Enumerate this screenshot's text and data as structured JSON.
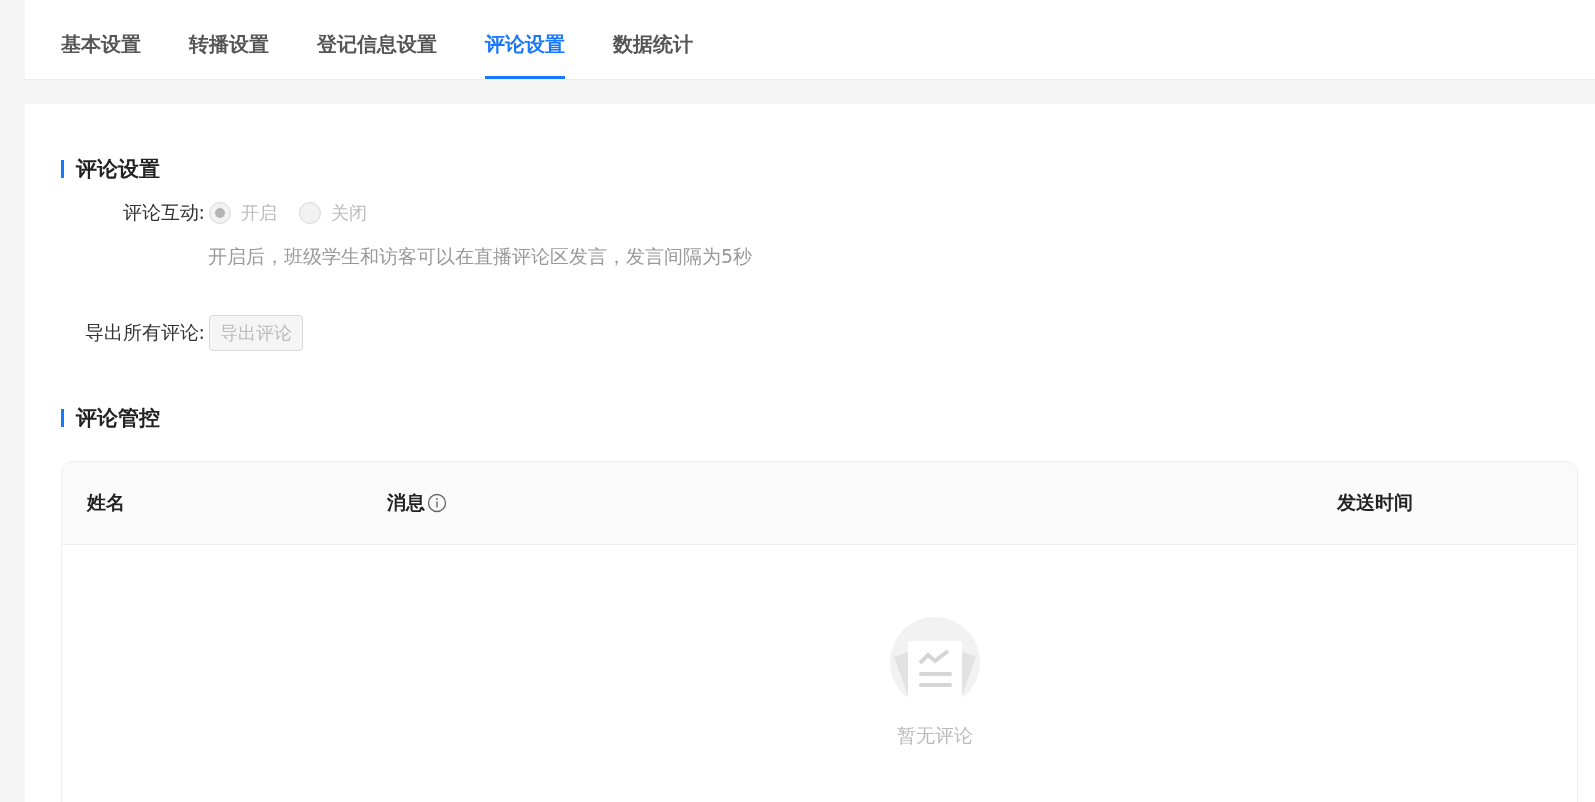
{
  "tabs": [
    {
      "label": "基本设置",
      "selected": false
    },
    {
      "label": "转播设置",
      "selected": false
    },
    {
      "label": "登记信息设置",
      "selected": false
    },
    {
      "label": "评论设置",
      "selected": true
    },
    {
      "label": "数据统计",
      "selected": false
    }
  ],
  "comment_settings": {
    "title": "评论设置",
    "interaction": {
      "label": "评论互动:",
      "disabled": true,
      "options": [
        {
          "label": "开启",
          "selected": true
        },
        {
          "label": "关闭",
          "selected": false
        }
      ],
      "hint": "开启后，班级学生和访客可以在直播评论区发言，发言间隔为5秒"
    },
    "export": {
      "label": "导出所有评论:",
      "button": "导出评论",
      "disabled": true
    }
  },
  "comment_control": {
    "title": "评论管控",
    "table": {
      "columns": [
        {
          "label": "姓名",
          "kind": "plain"
        },
        {
          "label": "消息",
          "kind": "with_info"
        },
        {
          "label": "发送时间",
          "kind": "plain"
        }
      ],
      "empty_text": "暂无评论"
    }
  }
}
